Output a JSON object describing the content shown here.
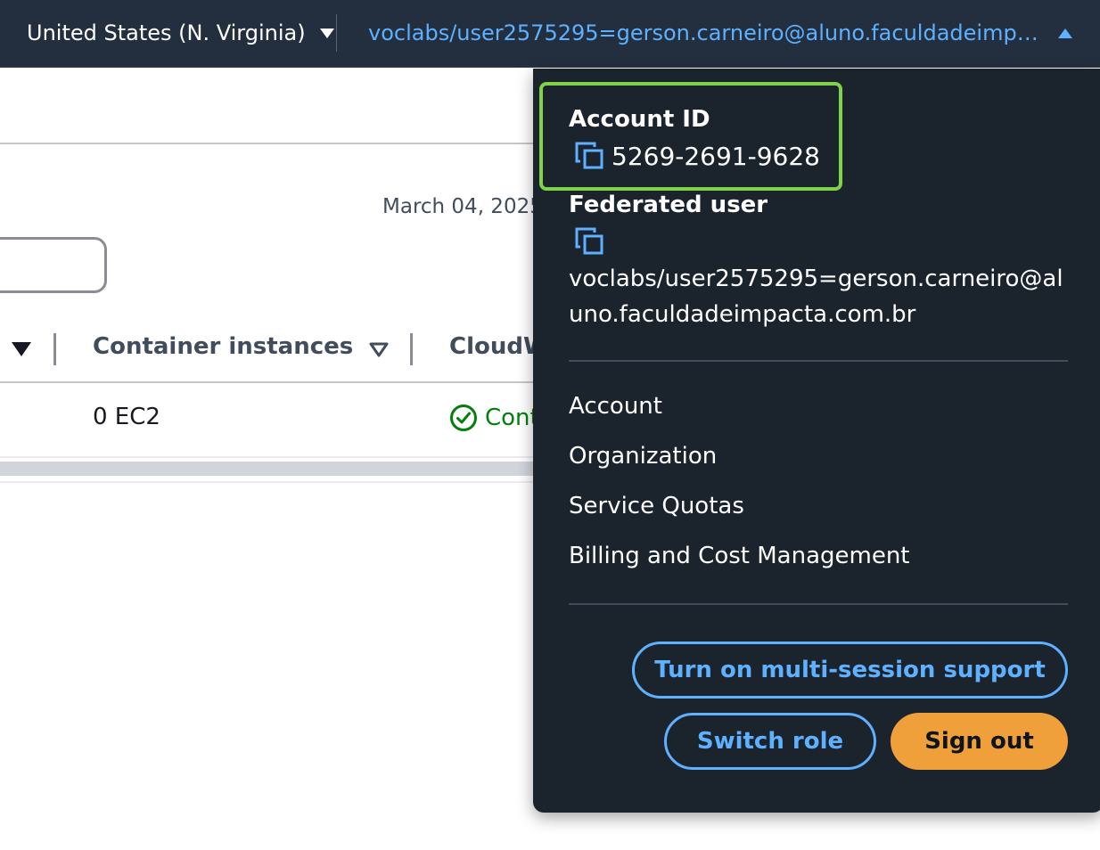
{
  "topbar": {
    "region": "United States (N. Virginia)",
    "account_label": "voclabs/user2575295=gerson.carneiro@aluno.faculdadeimpacta.co..."
  },
  "page": {
    "date": "March 04, 2025",
    "table": {
      "headers": [
        "Container instances",
        "CloudW"
      ],
      "row": {
        "container_instances": "0 EC2",
        "status": "Cont"
      }
    }
  },
  "dropdown": {
    "account_id_label": "Account ID",
    "account_id": "5269-2691-9628",
    "federated_user_label": "Federated user",
    "federated_user": "voclabs/user2575295=gerson.carneiro@aluno.faculdadeimpacta.com.br",
    "menu": [
      "Account",
      "Organization",
      "Service Quotas",
      "Billing and Cost Management"
    ],
    "buttons": {
      "multi_session": "Turn on multi-session support",
      "switch_role": "Switch role",
      "sign_out": "Sign out"
    }
  },
  "colors": {
    "nav_bg": "#232f3e",
    "dropdown_bg": "#1b232d",
    "link_blue": "#5db1ff",
    "highlight_green": "#7ed348",
    "signout_orange": "#f0a03a",
    "success_green": "#037f0c"
  },
  "icons": [
    "caret-down-icon",
    "caret-up-icon",
    "copy-icon",
    "sort-down-icon",
    "sort-outline-icon",
    "check-circle-icon"
  ]
}
